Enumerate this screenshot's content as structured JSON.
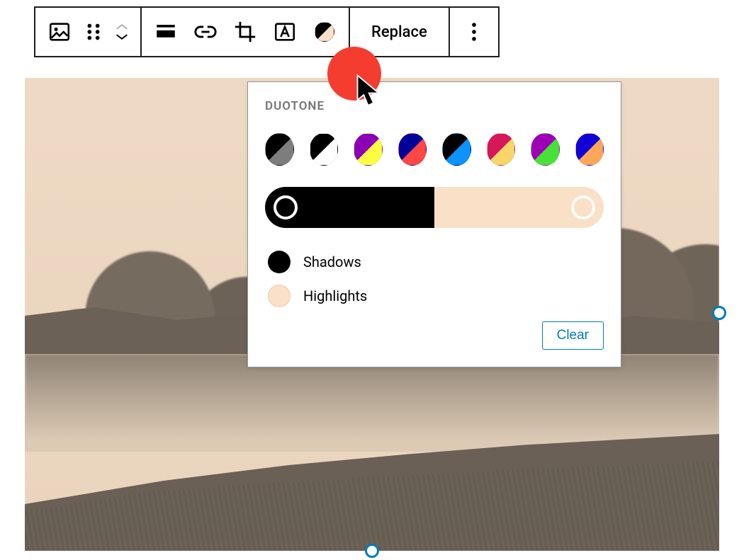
{
  "toolbar": {
    "replace_label": "Replace",
    "duotone_swatch": {
      "c1": "#000000",
      "c2": "#f9e0c7"
    }
  },
  "duotone": {
    "title": "DUOTONE",
    "presets": [
      {
        "name": "black-gray",
        "c1": "#000000",
        "c2": "#7d7d7d"
      },
      {
        "name": "black-white",
        "c1": "#000000",
        "c2": "#ffffff"
      },
      {
        "name": "purple-yellow",
        "c1": "#8c00b7",
        "c2": "#fcff41"
      },
      {
        "name": "navy-red",
        "c1": "#000099",
        "c2": "#ff4747"
      },
      {
        "name": "black-blue",
        "c1": "#000000",
        "c2": "#0b93ff"
      },
      {
        "name": "magenta-tan",
        "c1": "#d6185b",
        "c2": "#f6d66a"
      },
      {
        "name": "purple-green",
        "c1": "#9e00b5",
        "c2": "#48e236"
      },
      {
        "name": "blue-orange",
        "c1": "#1100d6",
        "c2": "#ffa658"
      }
    ],
    "gradient": {
      "shadows": "#000000",
      "highlights": "#f9e0c7"
    },
    "rows": {
      "shadows_label": "Shadows",
      "shadows_color": "#000000",
      "highlights_label": "Highlights",
      "highlights_color": "#f9e0c7"
    },
    "clear_label": "Clear"
  }
}
